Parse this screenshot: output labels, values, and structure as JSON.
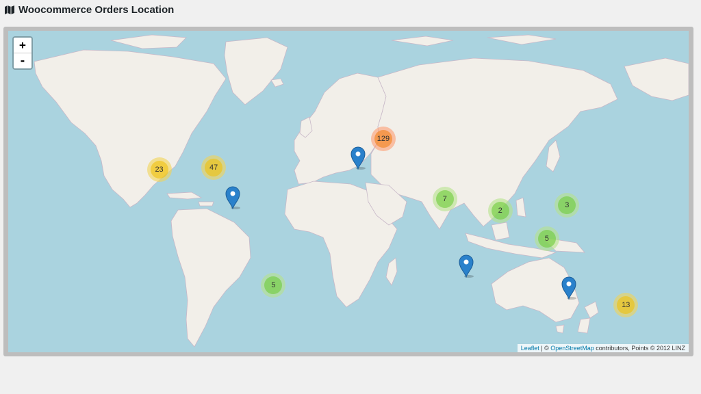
{
  "header": {
    "title": "Woocommerce Orders Location",
    "icon": "map-icon"
  },
  "map": {
    "zoom_in_label": "+",
    "zoom_out_label": "-",
    "clusters": [
      {
        "count": "129",
        "size": "large",
        "lat": 51.0,
        "lng": 10.5
      },
      {
        "count": "23",
        "size": "medium",
        "lat": 38.5,
        "lng": -117.0
      },
      {
        "count": "47",
        "size": "medium",
        "lat": 39.5,
        "lng": -86.0
      },
      {
        "count": "7",
        "size": "small",
        "lat": 24.0,
        "lng": 45.5
      },
      {
        "count": "2",
        "size": "small",
        "lat": 18.0,
        "lng": 77.0
      },
      {
        "count": "3",
        "size": "small",
        "lat": 21.0,
        "lng": 115.0
      },
      {
        "count": "5",
        "size": "small",
        "lat": 2.0,
        "lng": 103.5
      },
      {
        "count": "5",
        "size": "small",
        "lat": -24.0,
        "lng": -52.0
      },
      {
        "count": "13",
        "size": "medium",
        "lat": -34.0,
        "lng": 148.5
      }
    ],
    "markers": [
      {
        "name": "marker-spain",
        "lat": 38.5,
        "lng": -3.8
      },
      {
        "name": "marker-caribbean",
        "lat": 18.5,
        "lng": -75.0
      },
      {
        "name": "marker-mauritius",
        "lat": -20.0,
        "lng": 57.5
      },
      {
        "name": "marker-perth",
        "lat": -31.5,
        "lng": 116.0
      }
    ],
    "colors": {
      "water": "#aad3df",
      "land": "#f2efe9",
      "marker": "#2a81cb"
    }
  },
  "attribution": {
    "leaflet": "Leaflet",
    "sep": " | © ",
    "osm": "OpenStreetMap",
    "rest": " contributors, Points © 2012 LINZ"
  }
}
